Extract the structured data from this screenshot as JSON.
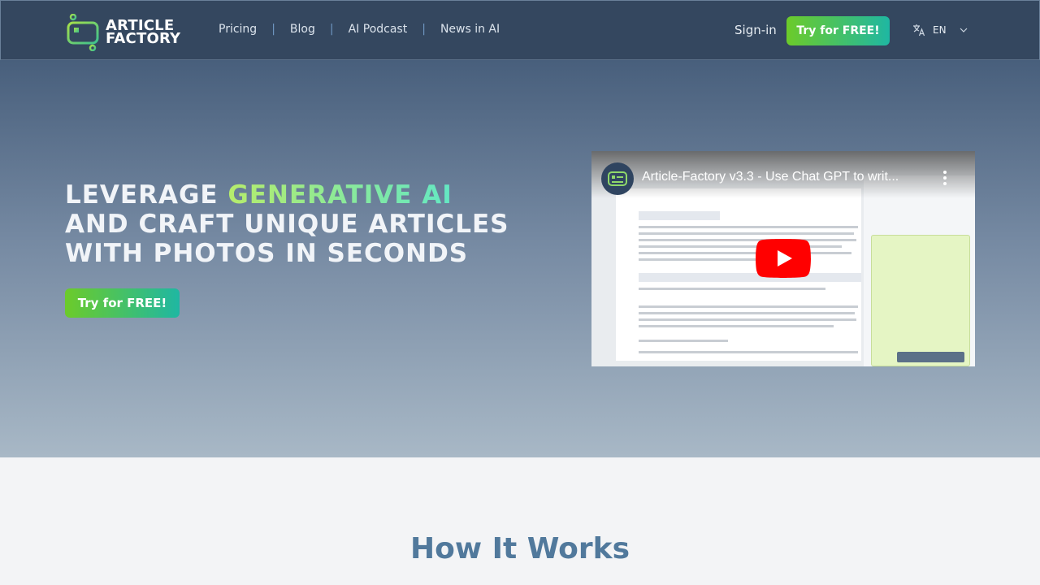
{
  "header": {
    "logo_line1": "ARTICLE",
    "logo_line2": "FACTORY",
    "nav": [
      {
        "label": "Pricing"
      },
      {
        "label": "Blog"
      },
      {
        "label": "AI Podcast"
      },
      {
        "label": "News in AI"
      }
    ],
    "separator": "|",
    "signin_label": "Sign-in",
    "cta_label": "Try for FREE!",
    "language": "EN",
    "colors": {
      "background": "#34475f",
      "cta_start": "#6ccb2a",
      "cta_end": "#1fb7a2"
    }
  },
  "hero": {
    "headline_part1": "LEVERAGE ",
    "headline_highlight": "GENERATIVE AI",
    "headline_part2": " AND CRAFT UNIQUE ARTICLES WITH PHOTOS IN SECONDS",
    "cta_label": "Try for FREE!",
    "video": {
      "title": "Article-Factory v3.3 - Use Chat GPT to writ...",
      "icon": "play-icon"
    }
  },
  "how": {
    "title": "How It Works"
  }
}
